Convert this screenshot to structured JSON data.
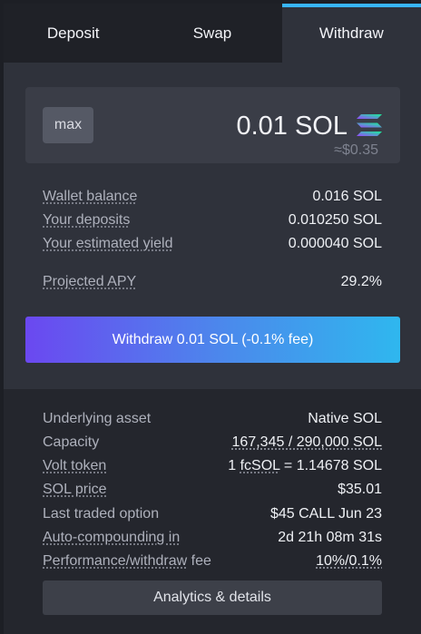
{
  "tabs": [
    {
      "label": "Deposit",
      "active": false
    },
    {
      "label": "Swap",
      "active": false
    },
    {
      "label": "Withdraw",
      "active": true
    }
  ],
  "amount": {
    "max_label": "max",
    "value": "0.01 SOL",
    "usd": "≈$0.35",
    "token_icon": "solana-icon"
  },
  "stats": {
    "wallet_balance_label": "Wallet balance",
    "wallet_balance_value": "0.016 SOL",
    "deposits_label": "Your deposits",
    "deposits_value": "0.010250 SOL",
    "yield_label": "Your estimated yield",
    "yield_value": "0.000040 SOL",
    "apy_label": "Projected APY",
    "apy_value": "29.2%"
  },
  "withdraw_button": "Withdraw 0.01 SOL (-0.1% fee)",
  "details": {
    "underlying_label": "Underlying asset",
    "underlying_value": "Native SOL",
    "capacity_label": "Capacity",
    "capacity_value": "167,345 / 290,000 SOL",
    "volt_label": "Volt token",
    "volt_value_prefix": "1 ",
    "volt_value_token": "fcSOL",
    "volt_value_suffix": " = 1.14678 SOL",
    "price_label": "SOL price",
    "price_value": "$35.01",
    "option_label": "Last traded option",
    "option_value": "$45 CALL Jun 23",
    "compounding_label": "Auto-compounding in",
    "compounding_value": "2d 21h 08m 31s",
    "fee_label_ul": "Performance/withdraw",
    "fee_label_rest": " fee",
    "fee_value": "10%/0.1%"
  },
  "analytics_button": "Analytics & details",
  "colors": {
    "accent": "#38b6ff",
    "button_gradient_start": "#6b48f0",
    "button_gradient_end": "#2fb7ee"
  }
}
